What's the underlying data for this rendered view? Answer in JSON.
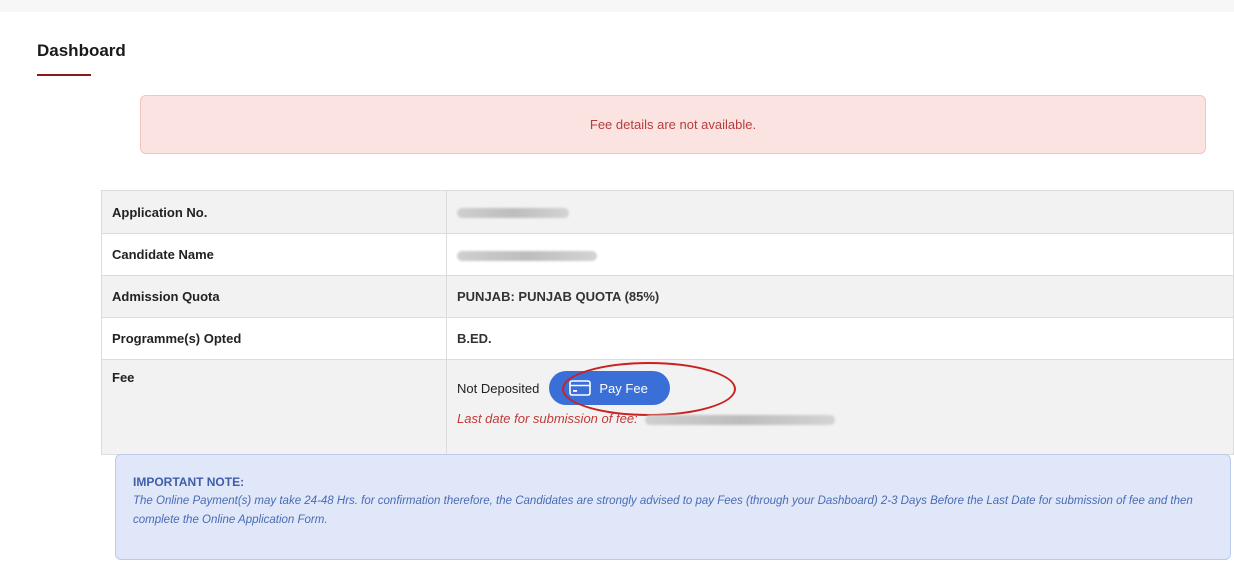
{
  "page": {
    "title": "Dashboard"
  },
  "alert": {
    "message": "Fee details are not available."
  },
  "details": {
    "application_no": {
      "label": "Application No."
    },
    "candidate_name": {
      "label": "Candidate Name"
    },
    "admission_quota": {
      "label": "Admission Quota",
      "value": "PUNJAB: PUNJAB QUOTA (85%)"
    },
    "programmes": {
      "label": "Programme(s) Opted",
      "value": "B.ED."
    },
    "fee": {
      "label": "Fee",
      "status": "Not Deposited",
      "pay_button_label": "Pay Fee",
      "pay_button_icon": "credit-card-icon",
      "deadline_text": "Last date for submission of fee:"
    }
  },
  "note": {
    "title": "IMPORTANT NOTE:",
    "body": "The Online Payment(s) may take 24-48 Hrs. for confirmation therefore, the Candidates are strongly advised to pay Fees (through your Dashboard) 2-3 Days Before the Last Date for submission of fee and then complete the Online Application Form."
  },
  "colors": {
    "accent": "#8b1a1a",
    "alert_bg": "#fbe3e1",
    "alert_text": "#b83d3a",
    "link_blue": "#3f5cab",
    "button_blue": "#3a6fd8",
    "annotation_red": "#c9211e",
    "note_bg": "#dfe7f8"
  }
}
